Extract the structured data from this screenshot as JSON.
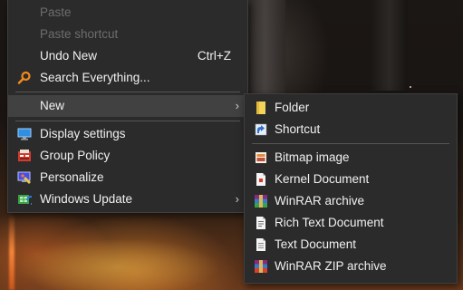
{
  "context_menu": {
    "items": [
      {
        "label": "Paste",
        "disabled": true
      },
      {
        "label": "Paste shortcut",
        "disabled": true
      },
      {
        "label": "Undo New",
        "accelerator": "Ctrl+Z"
      },
      {
        "label": "Search Everything...",
        "icon": "search-everything-icon"
      },
      {
        "label": "New",
        "submenu_arrow": "›"
      },
      {
        "label": "Display settings",
        "icon": "display-icon"
      },
      {
        "label": "Group Policy",
        "icon": "group-policy-icon"
      },
      {
        "label": "Personalize",
        "icon": "personalize-icon"
      },
      {
        "label": "Windows Update",
        "icon": "windows-update-icon",
        "submenu_arrow": "›"
      }
    ]
  },
  "new_submenu": {
    "items": [
      {
        "label": "Folder",
        "icon": "folder-icon"
      },
      {
        "label": "Shortcut",
        "icon": "shortcut-icon"
      },
      {
        "label": "Bitmap image",
        "icon": "bitmap-icon"
      },
      {
        "label": "Kernel Document",
        "icon": "kernel-document-icon"
      },
      {
        "label": "WinRAR archive",
        "icon": "winrar-archive-icon"
      },
      {
        "label": "Rich Text Document",
        "icon": "rich-text-icon"
      },
      {
        "label": "Text Document",
        "icon": "text-document-icon"
      },
      {
        "label": "WinRAR ZIP archive",
        "icon": "winrar-zip-icon"
      }
    ]
  },
  "colors": {
    "menu_bg": "#2b2b2b",
    "highlight": "#414141",
    "text": "#f1f1f1",
    "disabled_text": "#6d6d6d",
    "separator": "#555555"
  }
}
